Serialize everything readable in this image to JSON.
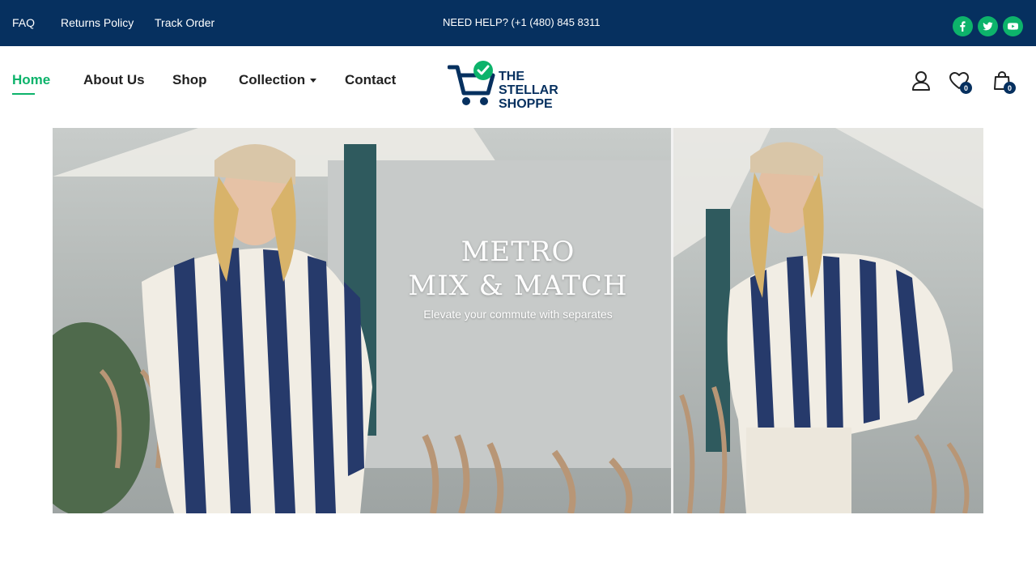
{
  "topbar": {
    "links": [
      "FAQ",
      "Returns Policy",
      "Track Order"
    ],
    "help": "NEED HELP? (+1 (480) 845 8311",
    "social_icons": [
      "facebook-icon",
      "twitter-icon",
      "youtube-icon"
    ],
    "bg_color": "#06305f",
    "accent_color": "#0db36b"
  },
  "nav": {
    "items": [
      "Home",
      "About Us",
      "Shop",
      "Collection",
      "Contact"
    ],
    "active": "Home"
  },
  "logo": {
    "line1": "THE STELLAR",
    "line2": "SHOPPE"
  },
  "header_icons": {
    "wishlist_count": "0",
    "cart_count": "0"
  },
  "hero": {
    "title_line1": "METRO",
    "title_line2": "MIX & MATCH",
    "subtitle": "Elevate your commute with separates"
  }
}
